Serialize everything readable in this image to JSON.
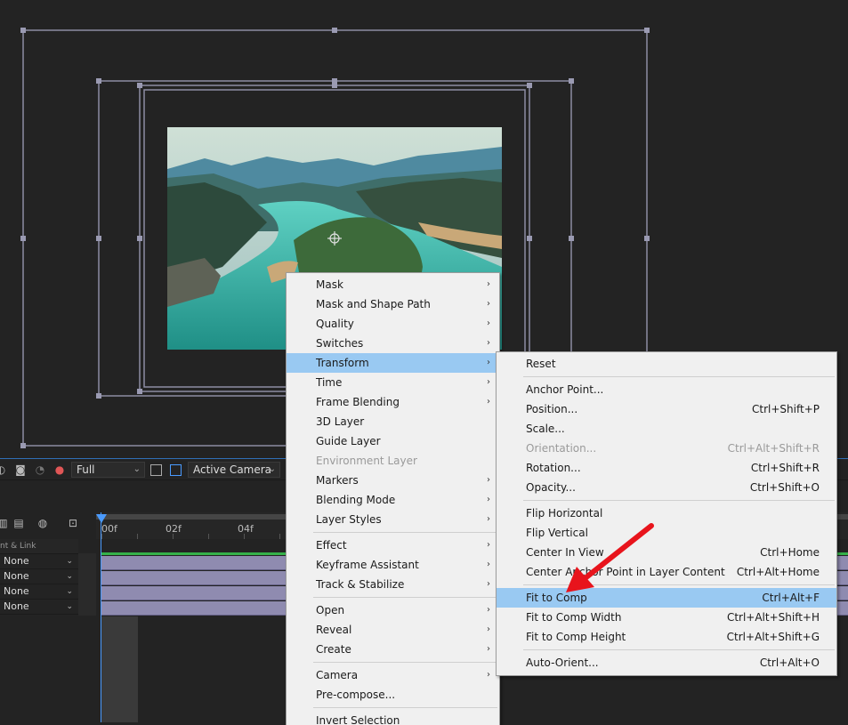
{
  "toolbar": {
    "resolution": "Full",
    "camera": "Active Camera"
  },
  "timeline": {
    "column_header": "nt & Link",
    "ruler_labels": [
      "00f",
      "02f",
      "04f"
    ],
    "parent_rows": [
      "None",
      "None",
      "None",
      "None"
    ]
  },
  "context_menu": {
    "items": [
      {
        "label": "Mask",
        "submenu": true
      },
      {
        "label": "Mask and Shape Path",
        "submenu": true
      },
      {
        "label": "Quality",
        "submenu": true
      },
      {
        "label": "Switches",
        "submenu": true
      },
      {
        "label": "Transform",
        "submenu": true,
        "highlighted": true
      },
      {
        "label": "Time",
        "submenu": true
      },
      {
        "label": "Frame Blending",
        "submenu": true
      },
      {
        "label": "3D Layer"
      },
      {
        "label": "Guide Layer"
      },
      {
        "label": "Environment Layer",
        "disabled": true
      },
      {
        "label": "Markers",
        "submenu": true
      },
      {
        "label": "Blending Mode",
        "submenu": true
      },
      {
        "label": "Layer Styles",
        "submenu": true
      },
      {
        "separator": true
      },
      {
        "label": "Effect",
        "submenu": true
      },
      {
        "label": "Keyframe Assistant",
        "submenu": true
      },
      {
        "label": "Track & Stabilize",
        "submenu": true
      },
      {
        "separator": true
      },
      {
        "label": "Open",
        "submenu": true
      },
      {
        "label": "Reveal",
        "submenu": true
      },
      {
        "label": "Create",
        "submenu": true
      },
      {
        "separator": true
      },
      {
        "label": "Camera",
        "submenu": true
      },
      {
        "label": "Pre-compose..."
      },
      {
        "separator": true
      },
      {
        "label": "Invert Selection"
      }
    ]
  },
  "transform_menu": {
    "items": [
      {
        "label": "Reset",
        "shortcut": ""
      },
      {
        "separator": true
      },
      {
        "label": "Anchor Point...",
        "shortcut": ""
      },
      {
        "label": "Position...",
        "shortcut": "Ctrl+Shift+P"
      },
      {
        "label": "Scale...",
        "shortcut": ""
      },
      {
        "label": "Orientation...",
        "shortcut": "Ctrl+Alt+Shift+R",
        "disabled": true
      },
      {
        "label": "Rotation...",
        "shortcut": "Ctrl+Shift+R"
      },
      {
        "label": "Opacity...",
        "shortcut": "Ctrl+Shift+O"
      },
      {
        "separator": true
      },
      {
        "label": "Flip Horizontal",
        "shortcut": ""
      },
      {
        "label": "Flip Vertical",
        "shortcut": ""
      },
      {
        "label": "Center In View",
        "shortcut": "Ctrl+Home"
      },
      {
        "label": "Center Anchor Point in Layer Content",
        "shortcut": "Ctrl+Alt+Home"
      },
      {
        "separator": true
      },
      {
        "label": "Fit to Comp",
        "shortcut": "Ctrl+Alt+F",
        "highlighted": true
      },
      {
        "label": "Fit to Comp Width",
        "shortcut": "Ctrl+Alt+Shift+H"
      },
      {
        "label": "Fit to Comp Height",
        "shortcut": "Ctrl+Alt+Shift+G"
      },
      {
        "separator": true
      },
      {
        "label": "Auto-Orient...",
        "shortcut": "Ctrl+Alt+O"
      }
    ]
  },
  "colors": {
    "menu_bg": "#f0f0f0",
    "highlight": "#99c9f2",
    "annotation_arrow": "#e8141c",
    "track": "#8f8bb0",
    "playhead": "#4a9bff"
  }
}
